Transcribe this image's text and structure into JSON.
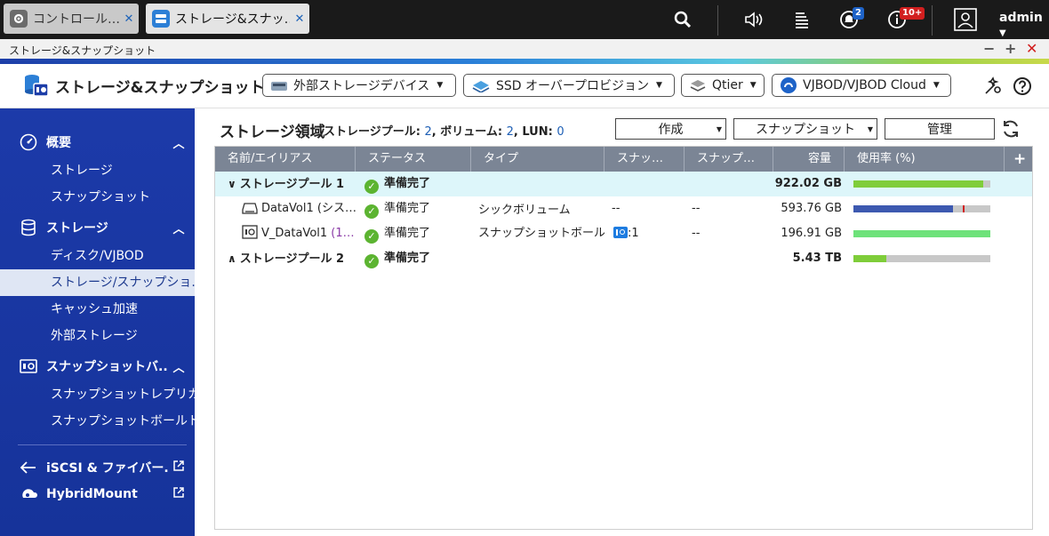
{
  "tabs": [
    {
      "label": "コントロール…",
      "close": "✕"
    },
    {
      "label": "ストレージ&スナッ…",
      "close": "✕"
    }
  ],
  "topbar": {
    "notification_count": "2",
    "info_count": "10+",
    "user": "admin",
    "icons": [
      "search-icon",
      "volume-icon",
      "task-stack-icon",
      "notification-icon",
      "info-icon",
      "user-icon"
    ]
  },
  "window": {
    "title": "ストレージ&スナップショット",
    "minimize": "−",
    "maximize": "+",
    "close": "✕"
  },
  "header": {
    "app_title": "ストレージ&スナップショット",
    "buttons": [
      {
        "label": "外部ストレージデバイス"
      },
      {
        "label": "SSD オーバープロビジョン"
      },
      {
        "label": "Qtier"
      },
      {
        "label": "VJBOD/VJBOD Cloud"
      }
    ]
  },
  "sidebar": {
    "sections": [
      {
        "label": "概要",
        "items": [
          {
            "label": "ストレージ"
          },
          {
            "label": "スナップショット"
          }
        ]
      },
      {
        "label": "ストレージ",
        "items": [
          {
            "label": "ディスク/VJBOD"
          },
          {
            "label": "ストレージ/スナップショ..."
          },
          {
            "label": "キャッシュ加速"
          },
          {
            "label": "外部ストレージ"
          }
        ]
      },
      {
        "label": "スナップショットバ...",
        "items": [
          {
            "label": "スナップショットレプリカ"
          },
          {
            "label": "スナップショットボールト"
          }
        ]
      }
    ],
    "links": [
      {
        "label": "iSCSI & ファイバー..."
      },
      {
        "label": "HybridMount"
      }
    ],
    "selected": "ストレージ/スナップショ..."
  },
  "main": {
    "title": "ストレージ領域",
    "stats": {
      "pool_label": "ストレージプール:",
      "pool_count": "2",
      "volume_label": "ボリューム:",
      "volume_count": "2",
      "lun_label": "LUN:",
      "lun_count": "0"
    },
    "actions": {
      "create": "作成",
      "snapshot": "スナップショット",
      "manage": "管理"
    },
    "columns": [
      "名前/エイリアス",
      "ステータス",
      "タイプ",
      "スナッ…",
      "スナップ…",
      "容量",
      "使用率 (%)"
    ],
    "add_column": "+",
    "rows": [
      {
        "name": "ストレージプール 1",
        "status": "準備完了",
        "type": "",
        "snap1": "",
        "snap2": "",
        "capacity": "922.02 GB",
        "usage": 0.95
      },
      {
        "name": "DataVol1 (シス…",
        "status": "準備完了",
        "type": "シックボリューム",
        "snap1": "--",
        "snap2": "--",
        "capacity": "593.76 GB",
        "usage": 0.73
      },
      {
        "name": "V_DataVol1",
        "alias": "(1…",
        "status": "準備完了",
        "type": "スナップショットボール",
        "snap1": ":1",
        "snap2": "--",
        "capacity": "196.91 GB",
        "usage": 1.0
      },
      {
        "name": "ストレージプール 2",
        "status": "準備完了",
        "type": "",
        "snap1": "",
        "snap2": "",
        "capacity": "5.43 TB",
        "usage": 0.24
      }
    ],
    "colors": {
      "pool_bar": "#7fcd3a",
      "volume_bar": "#3d59b0",
      "vault_bar": "#6ee27a",
      "threshold": "#d11e1e"
    }
  }
}
